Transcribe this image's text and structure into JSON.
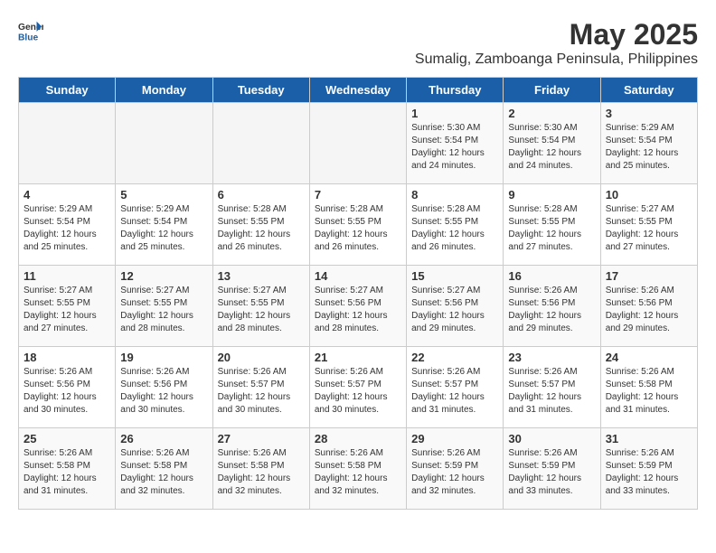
{
  "logo": {
    "general": "General",
    "blue": "Blue"
  },
  "title": {
    "month_year": "May 2025",
    "location": "Sumalig, Zamboanga Peninsula, Philippines"
  },
  "headers": [
    "Sunday",
    "Monday",
    "Tuesday",
    "Wednesday",
    "Thursday",
    "Friday",
    "Saturday"
  ],
  "weeks": [
    [
      {
        "date": "",
        "info": ""
      },
      {
        "date": "",
        "info": ""
      },
      {
        "date": "",
        "info": ""
      },
      {
        "date": "",
        "info": ""
      },
      {
        "date": "1",
        "info": "Sunrise: 5:30 AM\nSunset: 5:54 PM\nDaylight: 12 hours\nand 24 minutes."
      },
      {
        "date": "2",
        "info": "Sunrise: 5:30 AM\nSunset: 5:54 PM\nDaylight: 12 hours\nand 24 minutes."
      },
      {
        "date": "3",
        "info": "Sunrise: 5:29 AM\nSunset: 5:54 PM\nDaylight: 12 hours\nand 25 minutes."
      }
    ],
    [
      {
        "date": "4",
        "info": "Sunrise: 5:29 AM\nSunset: 5:54 PM\nDaylight: 12 hours\nand 25 minutes."
      },
      {
        "date": "5",
        "info": "Sunrise: 5:29 AM\nSunset: 5:54 PM\nDaylight: 12 hours\nand 25 minutes."
      },
      {
        "date": "6",
        "info": "Sunrise: 5:28 AM\nSunset: 5:55 PM\nDaylight: 12 hours\nand 26 minutes."
      },
      {
        "date": "7",
        "info": "Sunrise: 5:28 AM\nSunset: 5:55 PM\nDaylight: 12 hours\nand 26 minutes."
      },
      {
        "date": "8",
        "info": "Sunrise: 5:28 AM\nSunset: 5:55 PM\nDaylight: 12 hours\nand 26 minutes."
      },
      {
        "date": "9",
        "info": "Sunrise: 5:28 AM\nSunset: 5:55 PM\nDaylight: 12 hours\nand 27 minutes."
      },
      {
        "date": "10",
        "info": "Sunrise: 5:27 AM\nSunset: 5:55 PM\nDaylight: 12 hours\nand 27 minutes."
      }
    ],
    [
      {
        "date": "11",
        "info": "Sunrise: 5:27 AM\nSunset: 5:55 PM\nDaylight: 12 hours\nand 27 minutes."
      },
      {
        "date": "12",
        "info": "Sunrise: 5:27 AM\nSunset: 5:55 PM\nDaylight: 12 hours\nand 28 minutes."
      },
      {
        "date": "13",
        "info": "Sunrise: 5:27 AM\nSunset: 5:55 PM\nDaylight: 12 hours\nand 28 minutes."
      },
      {
        "date": "14",
        "info": "Sunrise: 5:27 AM\nSunset: 5:56 PM\nDaylight: 12 hours\nand 28 minutes."
      },
      {
        "date": "15",
        "info": "Sunrise: 5:27 AM\nSunset: 5:56 PM\nDaylight: 12 hours\nand 29 minutes."
      },
      {
        "date": "16",
        "info": "Sunrise: 5:26 AM\nSunset: 5:56 PM\nDaylight: 12 hours\nand 29 minutes."
      },
      {
        "date": "17",
        "info": "Sunrise: 5:26 AM\nSunset: 5:56 PM\nDaylight: 12 hours\nand 29 minutes."
      }
    ],
    [
      {
        "date": "18",
        "info": "Sunrise: 5:26 AM\nSunset: 5:56 PM\nDaylight: 12 hours\nand 30 minutes."
      },
      {
        "date": "19",
        "info": "Sunrise: 5:26 AM\nSunset: 5:56 PM\nDaylight: 12 hours\nand 30 minutes."
      },
      {
        "date": "20",
        "info": "Sunrise: 5:26 AM\nSunset: 5:57 PM\nDaylight: 12 hours\nand 30 minutes."
      },
      {
        "date": "21",
        "info": "Sunrise: 5:26 AM\nSunset: 5:57 PM\nDaylight: 12 hours\nand 30 minutes."
      },
      {
        "date": "22",
        "info": "Sunrise: 5:26 AM\nSunset: 5:57 PM\nDaylight: 12 hours\nand 31 minutes."
      },
      {
        "date": "23",
        "info": "Sunrise: 5:26 AM\nSunset: 5:57 PM\nDaylight: 12 hours\nand 31 minutes."
      },
      {
        "date": "24",
        "info": "Sunrise: 5:26 AM\nSunset: 5:58 PM\nDaylight: 12 hours\nand 31 minutes."
      }
    ],
    [
      {
        "date": "25",
        "info": "Sunrise: 5:26 AM\nSunset: 5:58 PM\nDaylight: 12 hours\nand 31 minutes."
      },
      {
        "date": "26",
        "info": "Sunrise: 5:26 AM\nSunset: 5:58 PM\nDaylight: 12 hours\nand 32 minutes."
      },
      {
        "date": "27",
        "info": "Sunrise: 5:26 AM\nSunset: 5:58 PM\nDaylight: 12 hours\nand 32 minutes."
      },
      {
        "date": "28",
        "info": "Sunrise: 5:26 AM\nSunset: 5:58 PM\nDaylight: 12 hours\nand 32 minutes."
      },
      {
        "date": "29",
        "info": "Sunrise: 5:26 AM\nSunset: 5:59 PM\nDaylight: 12 hours\nand 32 minutes."
      },
      {
        "date": "30",
        "info": "Sunrise: 5:26 AM\nSunset: 5:59 PM\nDaylight: 12 hours\nand 33 minutes."
      },
      {
        "date": "31",
        "info": "Sunrise: 5:26 AM\nSunset: 5:59 PM\nDaylight: 12 hours\nand 33 minutes."
      }
    ]
  ]
}
